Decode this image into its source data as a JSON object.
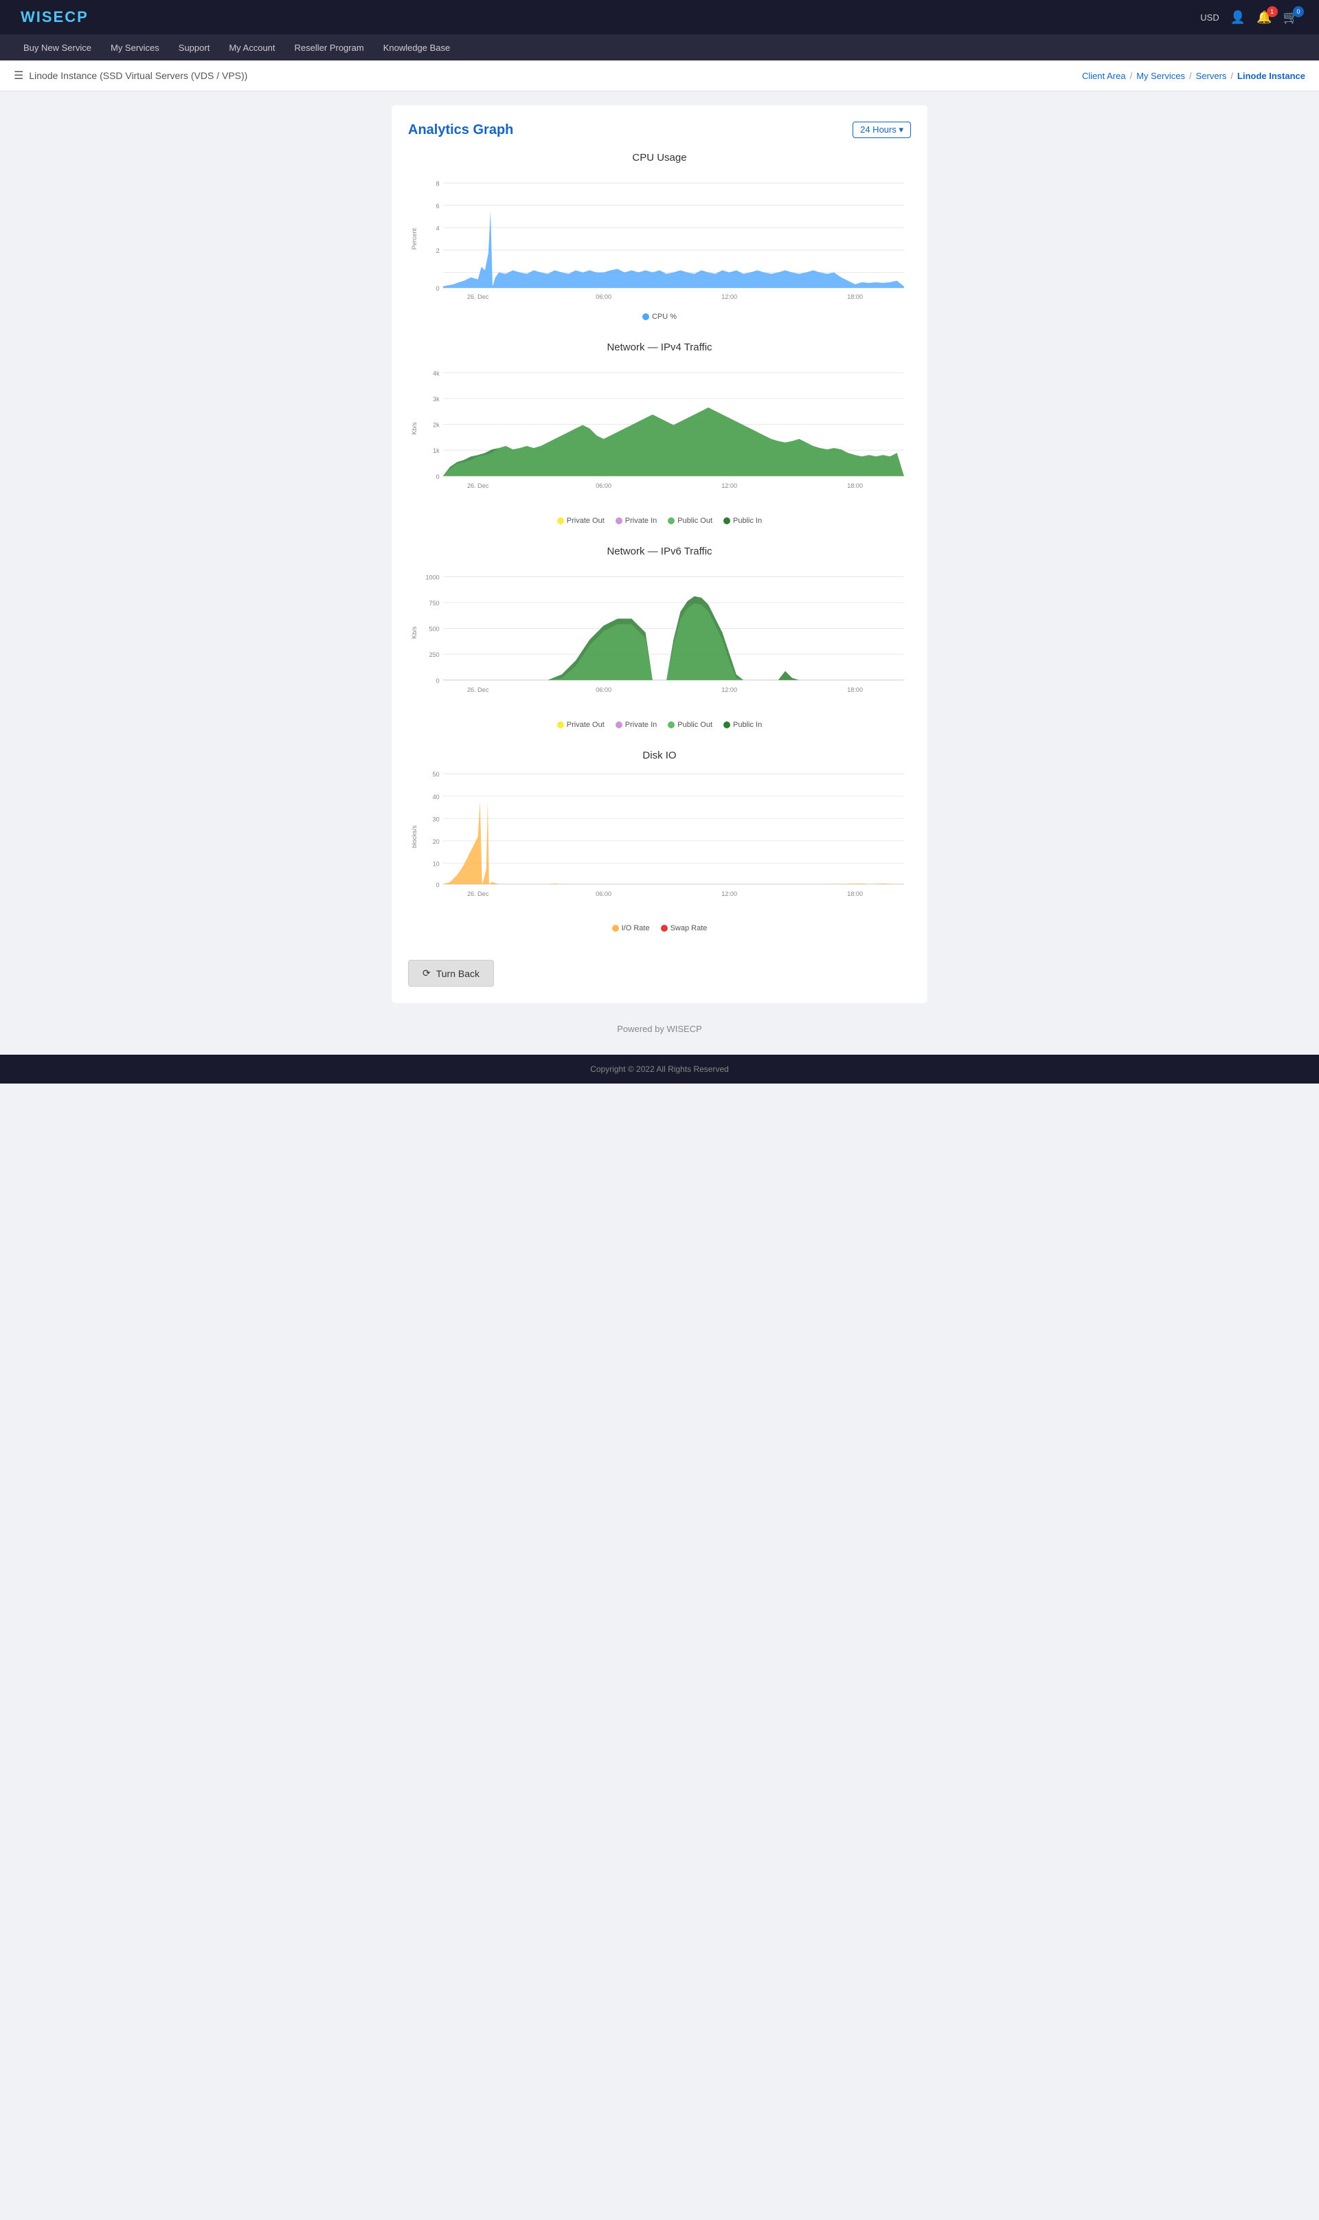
{
  "header": {
    "logo": "WISECP",
    "currency": "USD",
    "notification_count": "1",
    "cart_count": "0"
  },
  "nav": {
    "items": [
      {
        "label": "Buy New Service"
      },
      {
        "label": "My Services"
      },
      {
        "label": "Support"
      },
      {
        "label": "My Account"
      },
      {
        "label": "Reseller Program"
      },
      {
        "label": "Knowledge Base"
      }
    ]
  },
  "breadcrumb_bar": {
    "page_title": "Linode Instance (SSD Virtual Servers (VDS / VPS))",
    "breadcrumbs": [
      {
        "label": "Client Area",
        "active": false
      },
      {
        "label": "My Services",
        "active": false
      },
      {
        "label": "Servers",
        "active": false
      },
      {
        "label": "Linode Instance",
        "active": true
      }
    ]
  },
  "analytics": {
    "title": "Analytics Graph",
    "time_selector": "24 Hours ▾",
    "charts": [
      {
        "id": "cpu",
        "title": "CPU Usage",
        "y_label": "Percent",
        "y_ticks": [
          "8",
          "6",
          "4",
          "2",
          "0"
        ],
        "x_ticks": [
          "26. Dec",
          "06:00",
          "12:00",
          "18:00"
        ],
        "legend": [
          {
            "label": "CPU %",
            "color": "#4da6ff"
          }
        ]
      },
      {
        "id": "ipv4",
        "title": "Network — IPv4 Traffic",
        "y_label": "Kb/s",
        "y_ticks": [
          "4k",
          "3k",
          "2k",
          "1k",
          "0"
        ],
        "x_ticks": [
          "26. Dec",
          "06:00",
          "12:00",
          "18:00"
        ],
        "legend": [
          {
            "label": "Private Out",
            "color": "#ffeb3b"
          },
          {
            "label": "Private In",
            "color": "#ce93d8"
          },
          {
            "label": "Public Out",
            "color": "#66bb6a"
          },
          {
            "label": "Public In",
            "color": "#2e7d32"
          }
        ]
      },
      {
        "id": "ipv6",
        "title": "Network — IPv6 Traffic",
        "y_label": "Kb/s",
        "y_ticks": [
          "1000",
          "750",
          "500",
          "250",
          "0"
        ],
        "x_ticks": [
          "26. Dec",
          "06:00",
          "12:00",
          "18:00"
        ],
        "legend": [
          {
            "label": "Private Out",
            "color": "#ffeb3b"
          },
          {
            "label": "Private In",
            "color": "#ce93d8"
          },
          {
            "label": "Public Out",
            "color": "#66bb6a"
          },
          {
            "label": "Public In",
            "color": "#2e7d32"
          }
        ]
      },
      {
        "id": "diskio",
        "title": "Disk IO",
        "y_label": "blocks/s",
        "y_ticks": [
          "50",
          "40",
          "30",
          "20",
          "10",
          "0"
        ],
        "x_ticks": [
          "26. Dec",
          "06:00",
          "12:00",
          "18:00"
        ],
        "legend": [
          {
            "label": "I/O Rate",
            "color": "#ffb74d"
          },
          {
            "label": "Swap Rate",
            "color": "#e53935"
          }
        ]
      }
    ]
  },
  "buttons": {
    "turn_back": "Turn Back"
  },
  "footer": {
    "powered_by": "Powered by WISECP",
    "copyright": "Copyright © 2022 All Rights Reserved"
  }
}
